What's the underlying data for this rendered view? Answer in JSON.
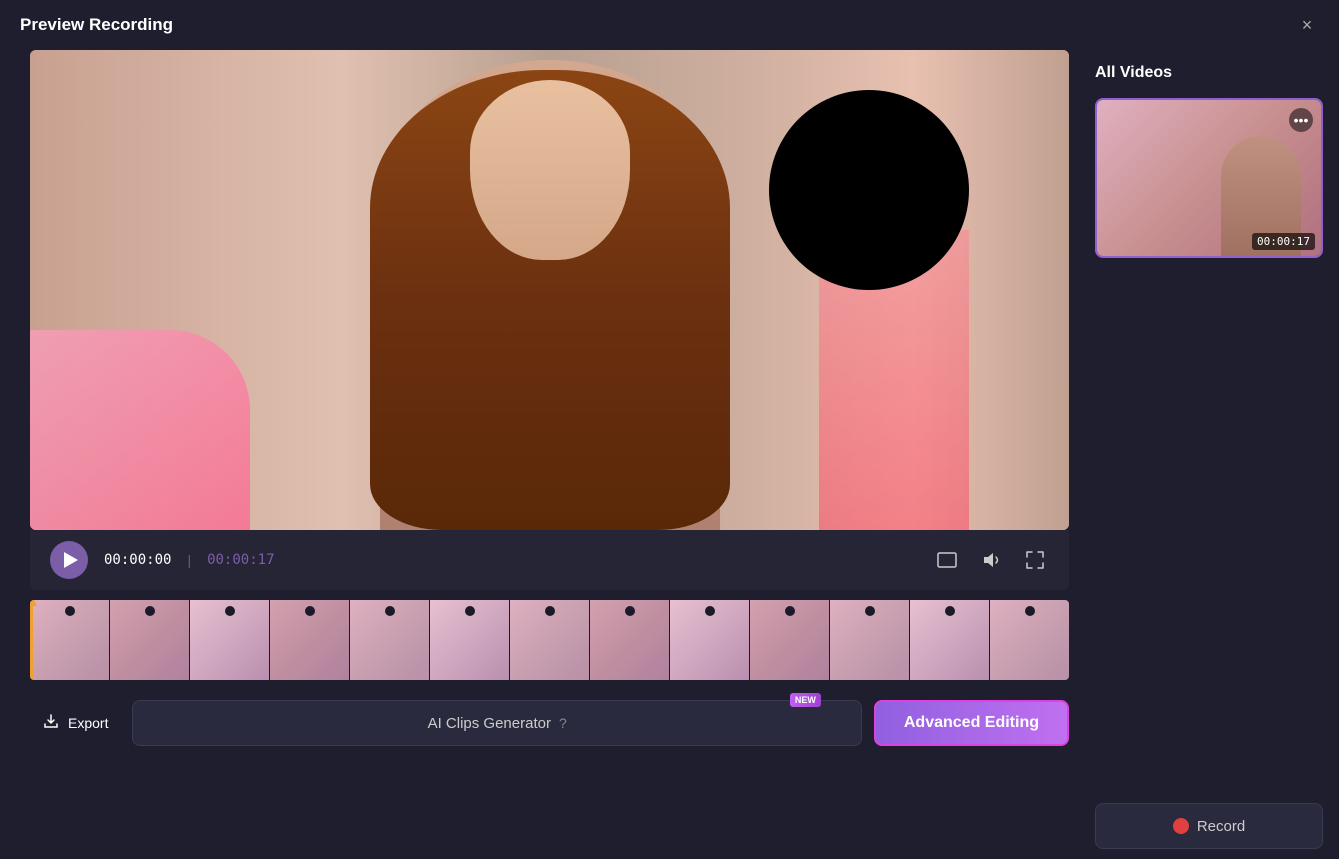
{
  "titleBar": {
    "title": "Preview Recording",
    "closeIcon": "×"
  },
  "videoPlayer": {
    "currentTime": "00:00:00",
    "separator": "|",
    "totalTime": "00:00:17",
    "timestampOverlay": ""
  },
  "controls": {
    "playLabel": "play",
    "aspectRatioIcon": "⊡",
    "volumeIcon": "🔊",
    "fullscreenIcon": "⛶"
  },
  "rightPanel": {
    "allVideosTitle": "All Videos",
    "videoDuration": "00:00:17",
    "moreOptionsLabel": "•••",
    "recordButtonLabel": "Record",
    "recordIcon": "⊕"
  },
  "bottomBar": {
    "exportLabel": "Export",
    "aiClipsLabel": "AI Clips Generator",
    "newBadge": "NEW",
    "helpIcon": "?",
    "advancedEditingLabel": "Advanced Editing"
  }
}
